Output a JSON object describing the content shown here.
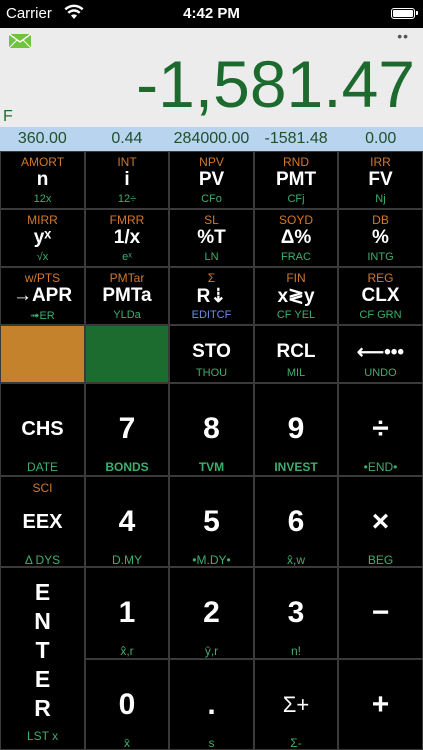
{
  "status": {
    "carrier": "Carrier",
    "time": "4:42 PM"
  },
  "display": {
    "value": "-1,581.47",
    "flag": "F",
    "menu_dots": "••"
  },
  "registers": [
    "360.00",
    "0.44",
    "284000.00",
    "-1581.48",
    "0.00"
  ],
  "keys": {
    "n": {
      "top": "AMORT",
      "main": "n",
      "bot": "12x"
    },
    "i": {
      "top": "INT",
      "main": "i",
      "bot": "12÷"
    },
    "pv": {
      "top": "NPV",
      "main": "PV",
      "bot": "CFo"
    },
    "pmt": {
      "top": "RND",
      "main": "PMT",
      "bot": "CFj"
    },
    "fv": {
      "top": "IRR",
      "main": "FV",
      "bot": "Nj"
    },
    "yx": {
      "top": "MIRR",
      "main": "yˣ",
      "bot": "√x"
    },
    "inv": {
      "top": "FMRR",
      "main": "1/x",
      "bot": "eˣ"
    },
    "pctt": {
      "top": "SL",
      "main": "%T",
      "bot": "LN"
    },
    "dpct": {
      "top": "SOYD",
      "main": "Δ%",
      "bot": "FRAC"
    },
    "pct": {
      "top": "DB",
      "main": "%",
      "bot": "INTG"
    },
    "apr": {
      "top": "w/PTS",
      "main": "→APR",
      "bot": "➟ER"
    },
    "pmta": {
      "top": "PMTar",
      "main": "PMTa",
      "bot": "YLDa"
    },
    "rdown": {
      "top": "Σ",
      "main": "R⇣",
      "bot": "EDITCF"
    },
    "xy": {
      "top": "FIN",
      "main": "x≷y",
      "bot": "CF YEL"
    },
    "clx": {
      "top": "REG",
      "main": "CLX",
      "bot": "CF GRN"
    },
    "sto": {
      "main": "STO",
      "bot": "THOU"
    },
    "rcl": {
      "main": "RCL",
      "bot": "MIL"
    },
    "bksp": {
      "main": "⟵•••",
      "bot": "UNDO"
    },
    "chs": {
      "main": "CHS",
      "bot": "DATE"
    },
    "k7": {
      "main": "7",
      "bot": "BONDS"
    },
    "k8": {
      "main": "8",
      "bot": "TVM"
    },
    "k9": {
      "main": "9",
      "bot": "INVEST"
    },
    "div": {
      "main": "÷",
      "bot": "•END•"
    },
    "eex": {
      "top": "SCI",
      "main": "EEX",
      "bot": "Δ DYS"
    },
    "k4": {
      "main": "4",
      "bot": "D.MY"
    },
    "k5": {
      "main": "5",
      "bot": "•M.DY•"
    },
    "k6": {
      "main": "6",
      "bot": "x̂,w"
    },
    "mul": {
      "main": "×",
      "bot": "BEG"
    },
    "enter": {
      "letters": [
        "E",
        "N",
        "T",
        "E",
        "R"
      ],
      "bot": "LST x"
    },
    "k1": {
      "main": "1",
      "bot": "x̂,r"
    },
    "k2": {
      "main": "2",
      "bot": "ŷ,r"
    },
    "k3": {
      "main": "3",
      "bot": "n!"
    },
    "sub": {
      "main": "−",
      "bot": ""
    },
    "k0": {
      "main": "0",
      "bot": "x̄"
    },
    "dot": {
      "main": ".",
      "bot": "s"
    },
    "sigp": {
      "main": "Σ+",
      "bot": "Σ-"
    },
    "add": {
      "main": "+",
      "bot": ""
    }
  }
}
